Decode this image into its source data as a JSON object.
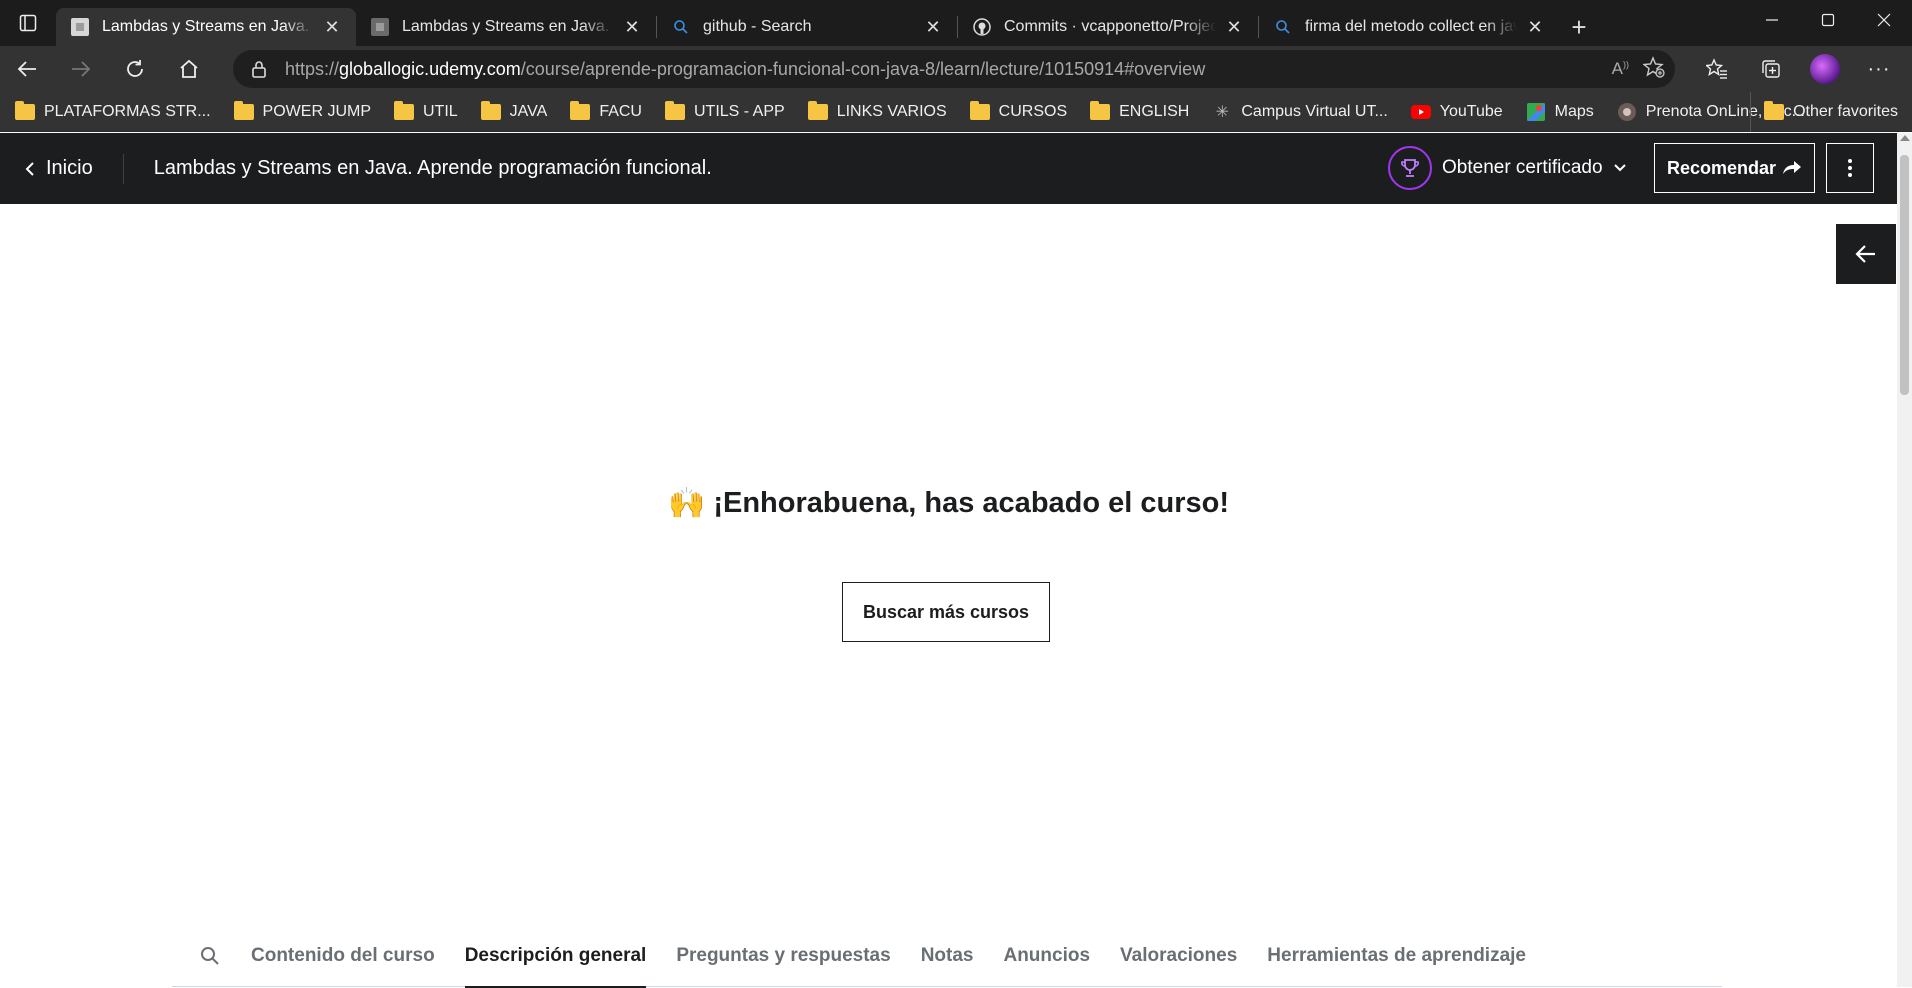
{
  "browser": {
    "tabs": [
      {
        "title": "Lambdas y Streams en Java. Aprende programación funcional.",
        "active": true,
        "icon": "udemy-favicon"
      },
      {
        "title": "Lambdas y Streams en Java. Aprende programación funcional.",
        "active": false,
        "icon": "udemy-favicon"
      },
      {
        "title": "github - Search",
        "active": false,
        "icon": "search-icon"
      },
      {
        "title": "Commits · vcapponetto/ProjectLambdas",
        "active": false,
        "icon": "github-icon"
      },
      {
        "title": "firma del metodo collect en java",
        "active": false,
        "icon": "search-icon"
      }
    ],
    "url_prefix": "https://",
    "url_host": "globallogic.udemy.com",
    "url_path": "/course/aprende-programacion-funcional-con-java-8/learn/lecture/10150914#overview",
    "bookmarks": [
      {
        "label": "PLATAFORMAS STR...",
        "icon": "folder-icon"
      },
      {
        "label": "POWER JUMP",
        "icon": "folder-icon"
      },
      {
        "label": "UTIL",
        "icon": "folder-icon"
      },
      {
        "label": "JAVA",
        "icon": "folder-icon"
      },
      {
        "label": "FACU",
        "icon": "folder-icon"
      },
      {
        "label": "UTILS - APP",
        "icon": "folder-icon"
      },
      {
        "label": "LINKS VARIOS",
        "icon": "folder-icon"
      },
      {
        "label": "CURSOS",
        "icon": "folder-icon"
      },
      {
        "label": "ENGLISH",
        "icon": "folder-icon"
      },
      {
        "label": "Campus Virtual UT...",
        "icon": "campus-icon"
      },
      {
        "label": "YouTube",
        "icon": "youtube-icon"
      },
      {
        "label": "Maps",
        "icon": "maps-icon"
      },
      {
        "label": "Prenota OnLine, acc...",
        "icon": "prenota-icon"
      }
    ],
    "other_favorites": "Other favorites"
  },
  "udemy": {
    "home_label": "Inicio",
    "course_title": "Lambdas y Streams en Java. Aprende programación funcional.",
    "certificate_label": "Obtener certificado",
    "recommend_label": "Recomendar",
    "accent_color": "#a435f0"
  },
  "main": {
    "congrats_emoji": "🙌",
    "congrats_text": "¡Enhorabuena, has acabado el curso!",
    "more_courses_label": "Buscar más cursos",
    "tabs": [
      {
        "label": "Contenido del curso",
        "active": false
      },
      {
        "label": "Descripción general",
        "active": true
      },
      {
        "label": "Preguntas y respuestas",
        "active": false
      },
      {
        "label": "Notas",
        "active": false
      },
      {
        "label": "Anuncios",
        "active": false
      },
      {
        "label": "Valoraciones",
        "active": false
      },
      {
        "label": "Herramientas de aprendizaje",
        "active": false
      }
    ]
  }
}
